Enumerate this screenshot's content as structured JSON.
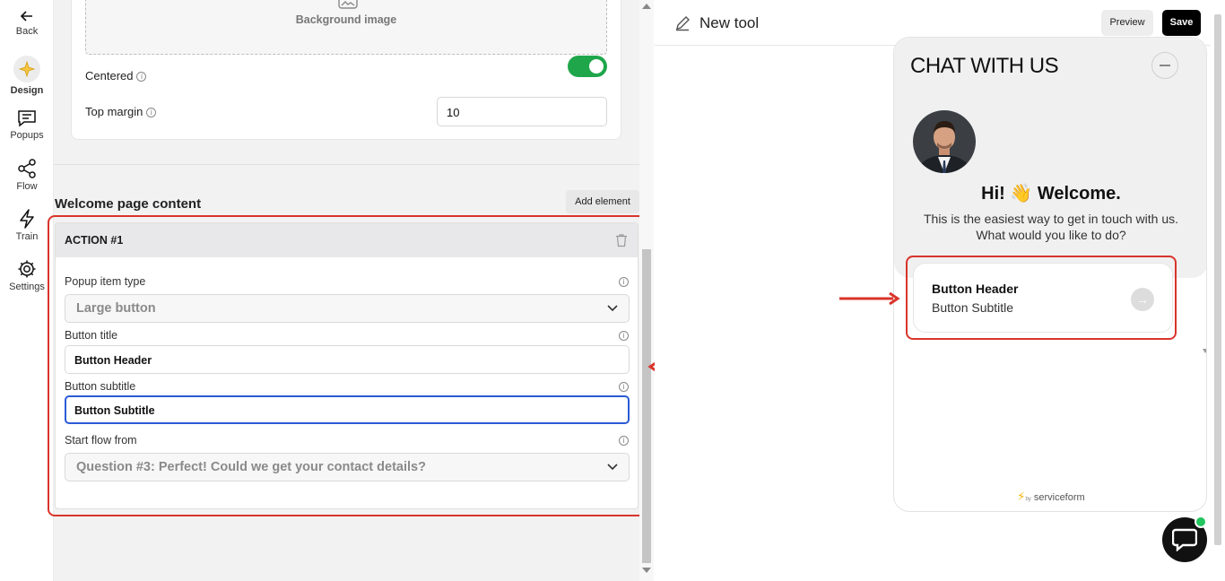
{
  "nav": {
    "back": "Back",
    "design": "Design",
    "popups": "Popups",
    "flow": "Flow",
    "train": "Train",
    "settings": "Settings"
  },
  "panel": {
    "background_image": "Background image",
    "centered_label": "Centered",
    "centered_on": true,
    "top_margin_label": "Top margin",
    "top_margin_value": "10",
    "section_title": "Welcome page content",
    "add_element": "Add element",
    "action": {
      "title": "ACTION #1",
      "popup_item_type_label": "Popup item type",
      "popup_item_type_value": "Large button",
      "button_title_label": "Button title",
      "button_title_value": "Button Header",
      "button_subtitle_label": "Button subtitle",
      "button_subtitle_value": "Button Subtitle",
      "start_flow_label": "Start flow from",
      "start_flow_value": "Question #3: Perfect! Could we get your contact details?"
    }
  },
  "topbar": {
    "tool_title": "New tool",
    "preview": "Preview",
    "save": "Save"
  },
  "widget": {
    "title": "CHAT WITH US",
    "greeting": "Hi! 👋 Welcome.",
    "description": "This is the easiest way to get in touch with us. What would you like to do?",
    "button_header": "Button Header",
    "button_subtitle": "Button Subtitle",
    "powered_by": "by",
    "brand": "serviceform"
  },
  "colors": {
    "accent_red": "#d9342b",
    "toggle_green": "#1fa64b",
    "focus_blue": "#2a5bd7",
    "online_green": "#22c55e"
  }
}
